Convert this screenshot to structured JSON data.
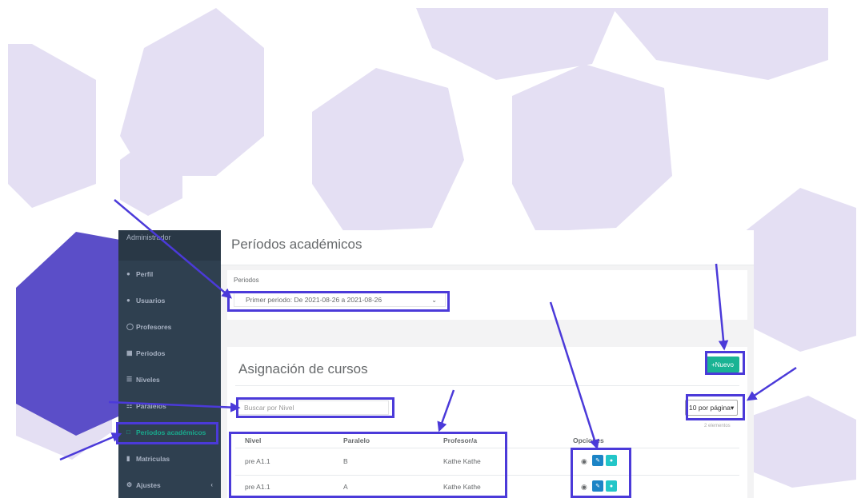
{
  "colors": {
    "accent": "#1ab394",
    "sidebar": "#2f4050",
    "annotation": "#4b3ad9"
  },
  "sidebar": {
    "header": "Administrador",
    "items": [
      {
        "label": "Perfil",
        "icon": "user-icon"
      },
      {
        "label": "Usuarios",
        "icon": "users-icon"
      },
      {
        "label": "Profesores",
        "icon": "user-circle-icon"
      },
      {
        "label": "Periodos",
        "icon": "table-icon"
      },
      {
        "label": "Niveles",
        "icon": "list-icon"
      },
      {
        "label": "Paralelos",
        "icon": "th-list-icon"
      },
      {
        "label": "Periodos académicos",
        "icon": "calendar-icon",
        "active": true
      },
      {
        "label": "Matriculas",
        "icon": "book-icon"
      },
      {
        "label": "Ajustes",
        "icon": "gear-icon"
      }
    ]
  },
  "header": {
    "title": "Períodos académicos"
  },
  "periodos": {
    "label": "Periodos",
    "selected": "Primer periodo: De 2021-08-26 a 2021-08-26"
  },
  "asignacion": {
    "title": "Asignación de cursos",
    "new_button": "+Nuevo",
    "search_placeholder": "Buscar por Nivel",
    "per_page": "10 por página",
    "count": "2 elementos",
    "columns": [
      "Nivel",
      "Paralelo",
      "Profesor/a",
      "Opciones"
    ],
    "rows": [
      {
        "nivel": "pre A1.1",
        "paralelo": "B",
        "profesor": "Kathe Kathe"
      },
      {
        "nivel": "pre A1.1",
        "paralelo": "A",
        "profesor": "Kathe Kathe"
      }
    ]
  }
}
